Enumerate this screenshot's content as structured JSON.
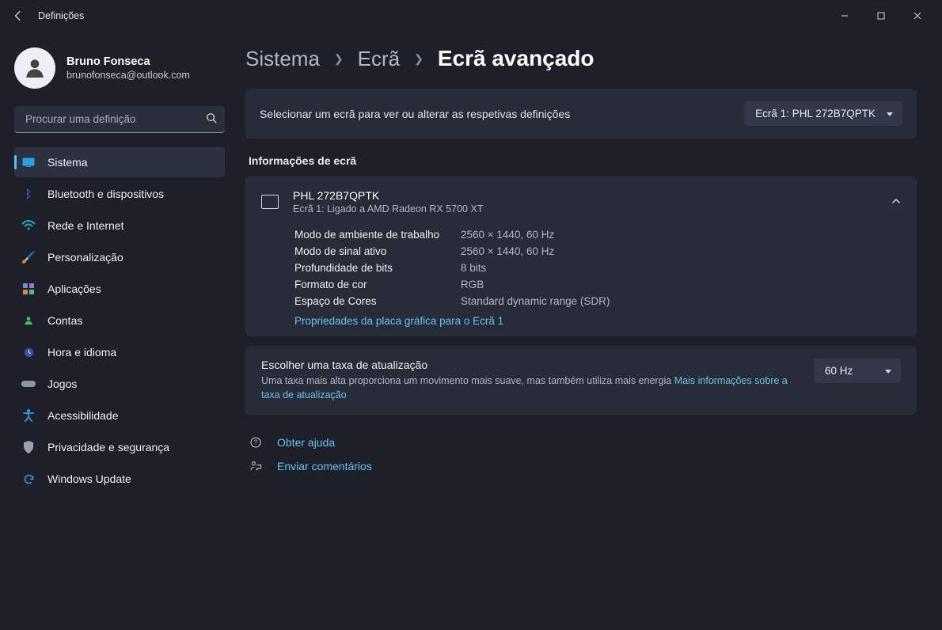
{
  "window": {
    "title": "Definições"
  },
  "account": {
    "name": "Bruno Fonseca",
    "email": "brunofonseca@outlook.com"
  },
  "search": {
    "placeholder": "Procurar uma definição"
  },
  "sidebar": {
    "items": [
      {
        "icon": "display-icon",
        "label": "Sistema",
        "active": true,
        "color": "#2aa0e8"
      },
      {
        "icon": "bluetooth-icon",
        "label": "Bluetooth e dispositivos",
        "color": "#3c7ff0"
      },
      {
        "icon": "wifi-icon",
        "label": "Rede e Internet",
        "color": "#18b1c8"
      },
      {
        "icon": "brush-icon",
        "label": "Personalização",
        "color": "#c97b2e"
      },
      {
        "icon": "apps-icon",
        "label": "Aplicações",
        "color": "#9a8bd6"
      },
      {
        "icon": "person-icon",
        "label": "Contas",
        "color": "#3fbf6a"
      },
      {
        "icon": "clock-icon",
        "label": "Hora e idioma",
        "color": "#5d7fe8"
      },
      {
        "icon": "game-icon",
        "label": "Jogos",
        "color": "#a0a7b6"
      },
      {
        "icon": "accessibility-icon",
        "label": "Acessibilidade",
        "color": "#2aa0e8"
      },
      {
        "icon": "shield-icon",
        "label": "Privacidade e segurança",
        "color": "#9aa2b1"
      },
      {
        "icon": "update-icon",
        "label": "Windows Update",
        "color": "#2aa0e8"
      }
    ]
  },
  "breadcrumb": [
    "Sistema",
    "Ecrã",
    "Ecrã avançado"
  ],
  "select_banner": {
    "message": "Selecionar um ecrã para ver ou alterar as respetivas definições",
    "selected": "Ecrã 1: PHL 272B7QPTK"
  },
  "info_section_title": "Informações de ecrã",
  "display": {
    "name": "PHL 272B7QPTK",
    "subtitle": "Ecrã 1: Ligado a AMD Radeon RX 5700 XT",
    "rows": [
      {
        "label": "Modo de ambiente de trabalho",
        "value": "2560 × 1440, 60 Hz"
      },
      {
        "label": "Modo de sinal ativo",
        "value": "2560 × 1440, 60 Hz"
      },
      {
        "label": "Profundidade de bits",
        "value": "8 bits"
      },
      {
        "label": "Formato de cor",
        "value": "RGB"
      },
      {
        "label": "Espaço de Cores",
        "value": "Standard dynamic range (SDR)"
      }
    ],
    "adapter_link": "Propriedades da placa gráfica para o Ecrã 1"
  },
  "refresh": {
    "title": "Escolher uma taxa de atualização",
    "desc_pre": "Uma taxa mais alta proporciona um movimento mais suave, mas também utiliza mais energia ",
    "more": "Mais informações sobre a taxa de atualização",
    "value": "60 Hz"
  },
  "footer": {
    "help": "Obter ajuda",
    "feedback": "Enviar comentários"
  }
}
